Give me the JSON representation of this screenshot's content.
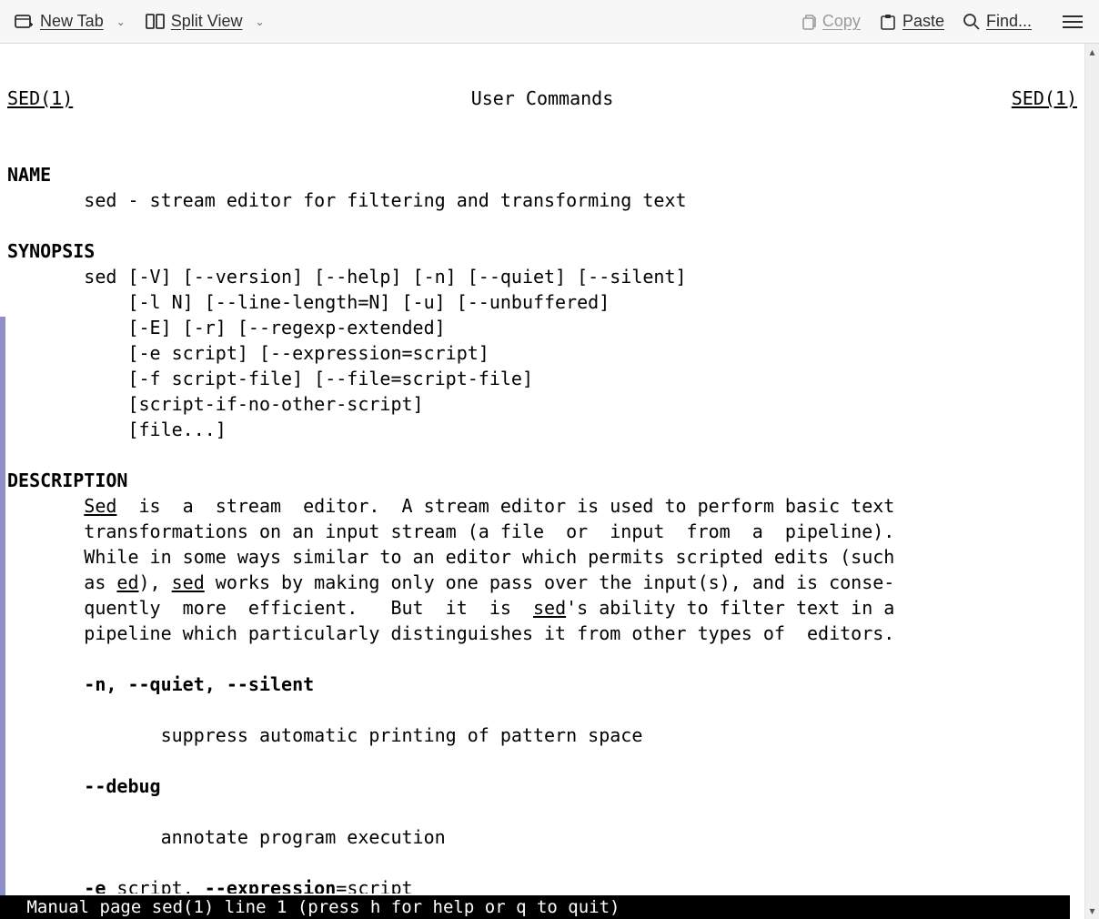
{
  "toolbar": {
    "newTab": "New Tab",
    "splitView": "Split View",
    "copy": "Copy",
    "paste": "Paste",
    "find": "Find..."
  },
  "man": {
    "headerLeft": "SED(1)",
    "headerCenter": "User Commands",
    "headerRight": "SED(1)",
    "sectionName": "NAME",
    "nameLine": "sed - stream editor for filtering and transforming text",
    "sectionSynopsis": "SYNOPSIS",
    "syn1": "sed [-V] [--version] [--help] [-n] [--quiet] [--silent]",
    "syn2": "    [-l N] [--line-length=N] [-u] [--unbuffered]",
    "syn3": "    [-E] [-r] [--regexp-extended]",
    "syn4": "    [-e script] [--expression=script]",
    "syn5": "    [-f script-file] [--file=script-file]",
    "syn6": "    [script-if-no-other-script]",
    "syn7": "    [file...]",
    "sectionDescription": "DESCRIPTION",
    "desc1a": "Sed",
    "desc1b": "  is  a  stream  editor.  A stream editor is used to perform basic text",
    "desc2": "transformations on an input stream (a file  or  input  from  a  pipeline).",
    "desc3": "While in some ways similar to an editor which permits scripted edits (such",
    "desc4a": "as ",
    "desc4b": "ed",
    "desc4c": "), ",
    "desc4d": "sed",
    "desc4e": " works by making only one pass over the input(s), and is conse-",
    "desc5a": "quently  more  efficient.   But  it  is  ",
    "desc5b": "sed",
    "desc5c": "'s ability to filter text in a",
    "desc6": "pipeline which particularly distinguishes it from other types of  editors.",
    "opt1": "-n, --quiet, --silent",
    "opt1desc": "suppress automatic printing of pattern space",
    "opt2": "--debug",
    "opt2desc": "annotate program execution",
    "opt3a": "-e",
    "opt3b": " script, ",
    "opt3c": "--expression",
    "opt3d": "=",
    "opt3e": "script",
    "status": " Manual page sed(1) line 1 (press h for help or q to quit)"
  }
}
